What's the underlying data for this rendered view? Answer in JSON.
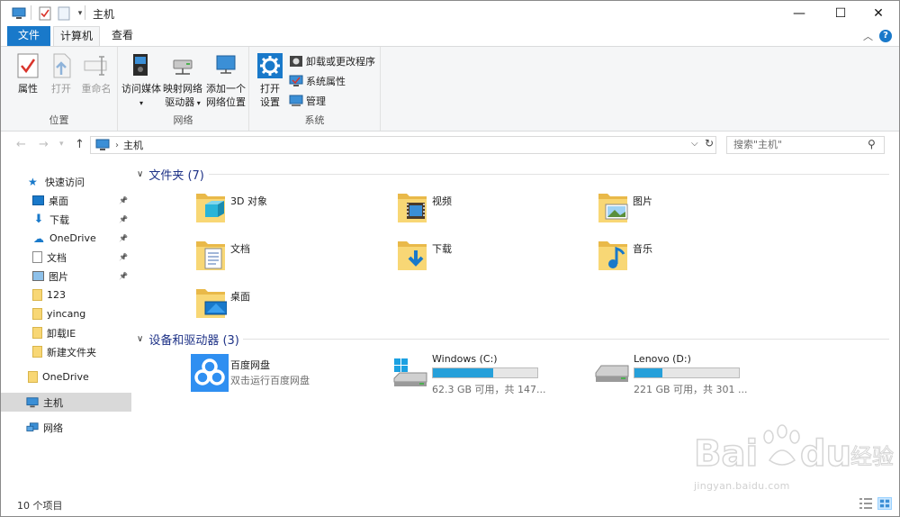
{
  "window": {
    "title": "主机"
  },
  "ribbon": {
    "tabs": {
      "file": "文件",
      "computer": "计算机",
      "view": "查看"
    },
    "help": "?",
    "buttons": {
      "properties": "属性",
      "open": "打开",
      "rename": "重命名",
      "access_media_1": "访问媒体",
      "map_drive_1": "映射网络",
      "map_drive_2": "驱动器",
      "add_location_1": "添加一个",
      "add_location_2": "网络位置",
      "open_settings_1": "打开",
      "open_settings_2": "设置",
      "uninstall": "卸载或更改程序",
      "system_properties": "系统属性",
      "manage": "管理"
    },
    "groups": {
      "location": "位置",
      "network": "网络",
      "system": "系统"
    }
  },
  "address": {
    "path": "主机",
    "search_placeholder": "搜索\"主机\""
  },
  "sidebar": {
    "quick_access": "快速访问",
    "items": [
      {
        "label": "桌面",
        "icon": "desktop-icon",
        "pinned": true
      },
      {
        "label": "下载",
        "icon": "download-icon",
        "pinned": true
      },
      {
        "label": "OneDrive",
        "icon": "cloud-icon",
        "pinned": true
      },
      {
        "label": "文档",
        "icon": "document-icon",
        "pinned": true
      },
      {
        "label": "图片",
        "icon": "picture-icon",
        "pinned": true
      },
      {
        "label": "123",
        "icon": "folder-icon",
        "pinned": false
      },
      {
        "label": "yincang",
        "icon": "folder-icon",
        "pinned": false
      },
      {
        "label": "卸载IE",
        "icon": "folder-icon",
        "pinned": false
      },
      {
        "label": "新建文件夹",
        "icon": "folder-icon",
        "pinned": false
      }
    ],
    "onedrive": "OneDrive",
    "this_pc": "主机",
    "network": "网络"
  },
  "content": {
    "folders_header": "文件夹 (7)",
    "folders": [
      {
        "label": "3D 对象",
        "icon": "3d-objects-icon"
      },
      {
        "label": "视频",
        "icon": "video-folder-icon"
      },
      {
        "label": "图片",
        "icon": "picture-folder-icon"
      },
      {
        "label": "文档",
        "icon": "document-folder-icon"
      },
      {
        "label": "下载",
        "icon": "download-folder-icon"
      },
      {
        "label": "音乐",
        "icon": "music-folder-icon"
      },
      {
        "label": "桌面",
        "icon": "desktop-folder-icon"
      }
    ],
    "devices_header": "设备和驱动器 (3)",
    "baidu": {
      "name": "百度网盘",
      "subtitle": "双击运行百度网盘"
    },
    "drives": [
      {
        "name": "Windows (C:)",
        "free_text": "62.3 GB 可用，共 147...",
        "used_fraction": 0.58
      },
      {
        "name": "Lenovo (D:)",
        "free_text": "221 GB 可用，共 301 ...",
        "used_fraction": 0.27
      }
    ]
  },
  "status": {
    "item_count": "10 个项目"
  },
  "watermark": {
    "brand": "Bai",
    "brand2": "du",
    "cn": "经验",
    "url": "jingyan.baidu.com"
  },
  "colors": {
    "accent": "#1979ca",
    "folder": "#f8d775",
    "drive_fill": "#26a0da"
  }
}
